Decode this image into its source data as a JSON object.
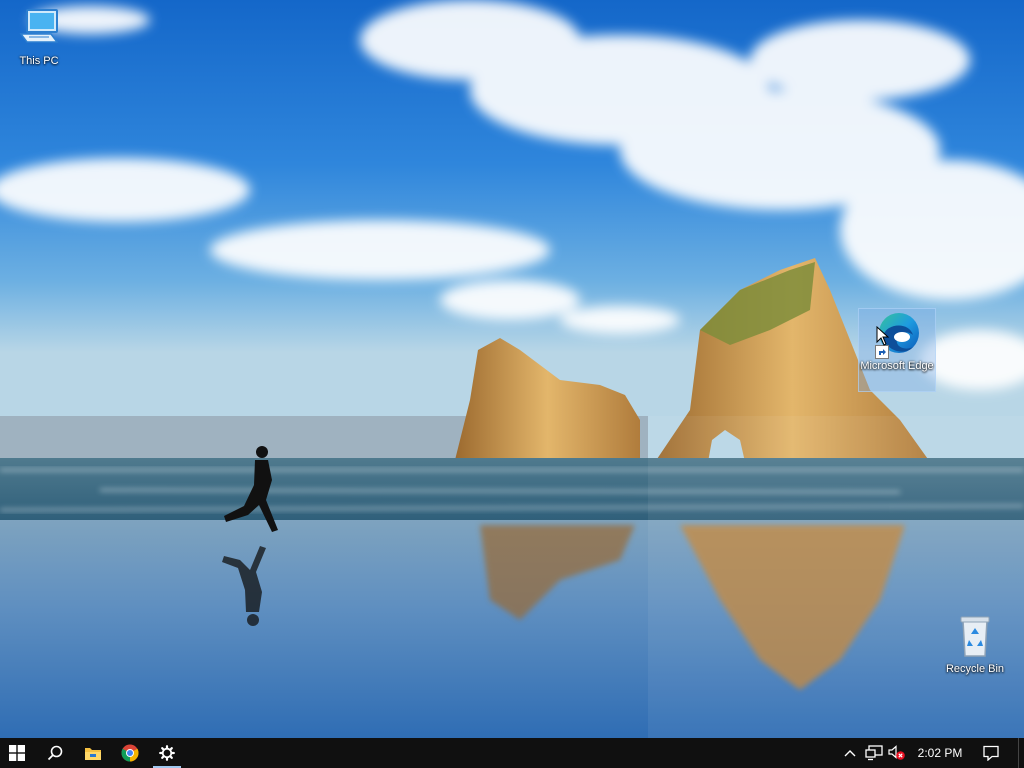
{
  "desktop": {
    "icons": [
      {
        "label": "This PC",
        "icon": "computer-icon"
      },
      {
        "label": "Microsoft Edge",
        "icon": "edge-icon"
      },
      {
        "label": "Recycle Bin",
        "icon": "recycle-bin-icon"
      }
    ]
  },
  "taskbar": {
    "buttons": [
      {
        "name": "Start",
        "icon": "windows-logo-icon"
      },
      {
        "name": "Search",
        "icon": "search-icon"
      },
      {
        "name": "File Explorer",
        "icon": "folder-icon"
      },
      {
        "name": "Google Chrome",
        "icon": "chrome-icon"
      },
      {
        "name": "Settings",
        "icon": "gear-icon"
      }
    ],
    "tray": {
      "clock": "2:02 PM",
      "icons": [
        "chevron-up-icon",
        "network-icon",
        "volume-muted-icon",
        "notification-icon"
      ]
    }
  },
  "colors": {
    "taskbar": "#101010",
    "accent": "#0078d7",
    "active_indicator": "#9fc7ee"
  }
}
